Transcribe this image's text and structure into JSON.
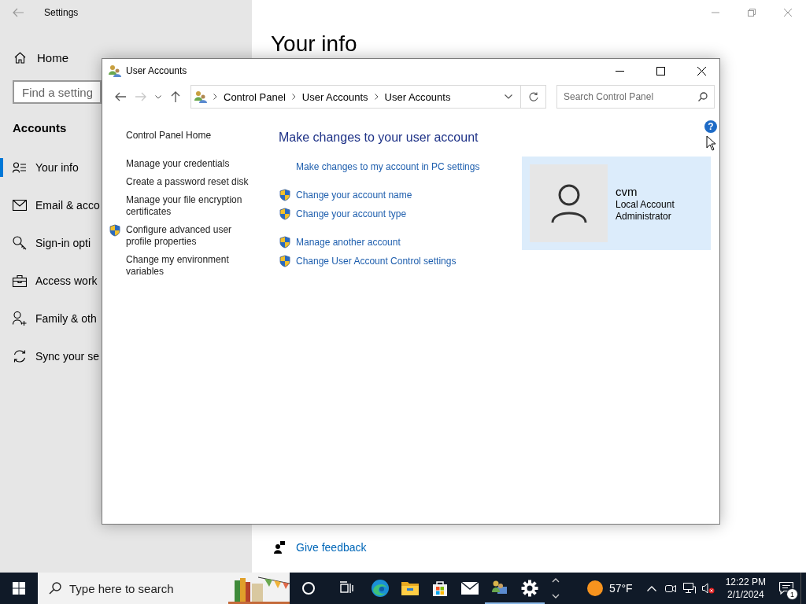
{
  "settings": {
    "title": "Settings",
    "home": "Home",
    "search": {
      "placeholder": "Find a setting"
    },
    "section": "Accounts",
    "nav": [
      {
        "kind": "info",
        "label": "Your info",
        "selected": true
      },
      {
        "kind": "mail",
        "label": "Email & acco",
        "selected": false
      },
      {
        "kind": "key",
        "label": "Sign-in opti",
        "selected": false
      },
      {
        "kind": "briefcase",
        "label": "Access work",
        "selected": false
      },
      {
        "kind": "family",
        "label": "Family & oth",
        "selected": false
      },
      {
        "kind": "sync",
        "label": "Sync your se",
        "selected": false
      }
    ],
    "heading": "Your info",
    "feedback": "Give feedback"
  },
  "control_panel": {
    "title": "User Accounts",
    "nav_buttons": [
      {
        "kind": "back",
        "disabled": false
      },
      {
        "kind": "forward",
        "disabled": true
      }
    ],
    "breadcrumbs": [
      "Control Panel",
      "User Accounts",
      "User Accounts"
    ],
    "search": {
      "placeholder": "Search Control Panel"
    },
    "help": "?",
    "home_link": "Control Panel Home",
    "sidebar": {
      "items": [
        {
          "label": "Manage your credentials",
          "shield": false
        },
        {
          "label": "Create a password reset disk",
          "shield": false
        },
        {
          "label": "Manage your file encryption certificates",
          "shield": false
        },
        {
          "label": "Configure advanced user profile properties",
          "shield": true
        },
        {
          "label": "Change my environment variables",
          "shield": false
        }
      ]
    },
    "heading": "Make changes to your user account",
    "link_groups": [
      [
        {
          "label": "Make changes to my account in PC settings",
          "shield": false
        }
      ],
      [
        {
          "label": "Change your account name",
          "shield": true
        },
        {
          "label": "Change your account type",
          "shield": true
        }
      ],
      [
        {
          "label": "Manage another account",
          "shield": true
        },
        {
          "label": "Change User Account Control settings",
          "shield": true
        }
      ]
    ],
    "account": {
      "name": "cvm",
      "type": "Local Account",
      "role": "Administrator"
    }
  },
  "taskbar": {
    "search": {
      "placeholder": "Type here to search"
    },
    "apps": [
      {
        "kind": "cortana",
        "running": false
      },
      {
        "kind": "taskview",
        "running": false
      },
      {
        "kind": "edge",
        "running": false
      },
      {
        "kind": "folder",
        "running": false
      },
      {
        "kind": "store",
        "running": false
      },
      {
        "kind": "mail",
        "running": false
      },
      {
        "kind": "users",
        "running": true
      },
      {
        "kind": "gear",
        "running": true
      }
    ],
    "weather": "57°F",
    "time": "12:22 PM",
    "date": "2/1/2024",
    "notifications": "1"
  }
}
